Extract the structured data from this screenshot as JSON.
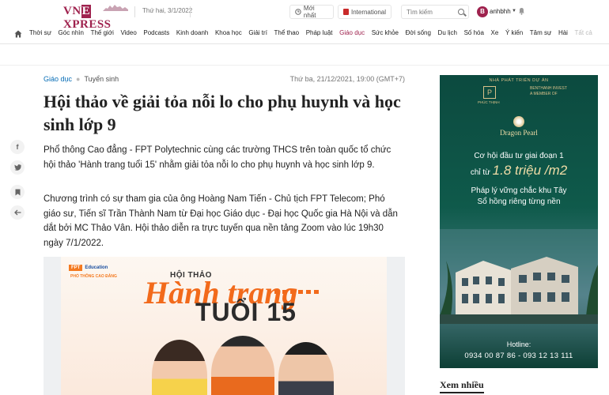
{
  "header": {
    "logo_text_a": "VN",
    "logo_text_x": "E",
    "logo_text_b": "XPRESS",
    "date": "Thứ hai, 3/1/2022",
    "latest_label": "Mới nhất",
    "international_label": "International",
    "search_placeholder": "Tìm kiếm",
    "avatar_letter": "B",
    "username": "anhbhh",
    "icons": [
      "clock-icon",
      "international-icon",
      "search-icon",
      "bell-icon"
    ]
  },
  "nav": {
    "items": [
      {
        "label": "Thời sự"
      },
      {
        "label": "Góc nhìn"
      },
      {
        "label": "Thế giới"
      },
      {
        "label": "Video"
      },
      {
        "label": "Podcasts"
      },
      {
        "label": "Kinh doanh"
      },
      {
        "label": "Khoa học"
      },
      {
        "label": "Giải trí"
      },
      {
        "label": "Thể thao"
      },
      {
        "label": "Pháp luật"
      },
      {
        "label": "Giáo dục"
      },
      {
        "label": "Sức khỏe"
      },
      {
        "label": "Đời sống"
      },
      {
        "label": "Du lịch"
      },
      {
        "label": "Số hóa"
      },
      {
        "label": "Xe"
      },
      {
        "label": "Ý kiến"
      },
      {
        "label": "Tâm sự"
      },
      {
        "label": "Hài"
      },
      {
        "label": "Tất cả"
      }
    ],
    "active_index": 10,
    "accent_color": "#9f224e"
  },
  "article": {
    "breadcrumb_category": "Giáo dục",
    "breadcrumb_sub": "Tuyển sinh",
    "published": "Thứ ba, 21/12/2021, 19:00 (GMT+7)",
    "title": "Hội thảo về giải tỏa nỗi lo cho phụ huynh và học sinh lớp 9",
    "lead": "Phổ thông Cao đẳng - FPT Polytechnic cùng các trường THCS trên toàn quốc tổ chức hội thảo 'Hành trang tuổi 15' nhằm giải tỏa nỗi lo cho phụ huynh và học sinh lớp 9.",
    "paragraph": "Chương trình có sự tham gia của ông Hoàng Nam Tiến - Chủ tịch FPT Telecom; Phó giáo sư, Tiến sĩ Trần Thành Nam từ Đại học Giáo dục - Đại học Quốc gia Hà Nội và dẫn dắt bởi MC Thảo Vân. Hội thảo diễn ra trực tuyến qua nền tảng Zoom vào lúc 19h30 ngày 7/1/2022.",
    "share_icons": [
      "facebook-icon",
      "twitter-icon",
      "bookmark-icon",
      "back-icon"
    ],
    "hero": {
      "brand": "FPT",
      "brand_sub": "Education",
      "school": "PHỔ THÔNG CAO ĐẲNG",
      "event_small": "HỘI THẢO",
      "event_big": "Hành trang",
      "event_age": "TUỔI 15"
    }
  },
  "ad": {
    "top_label": "NHÀ PHÁT TRIỂN DỰ ÁN",
    "partner1": "PHÚC THỊNH",
    "partner2_l1": "BENTHANH INVEST",
    "partner2_l2": "A MEMBER OF",
    "project": "Dragon Pearl",
    "line1": "Cơ hội đầu tư giai đoạn 1",
    "line2_prefix": "chỉ từ",
    "line2_big": "1.8 triệu /m2",
    "line3a": "Pháp lý vững chắc khu Tây",
    "line3b": "Sổ hồng riêng từng nền",
    "hotline_label": "Hotline:",
    "phones": "0934 00 87 86 - 093 12 13 111"
  },
  "sidebar": {
    "most_read": "Xem nhiều"
  }
}
